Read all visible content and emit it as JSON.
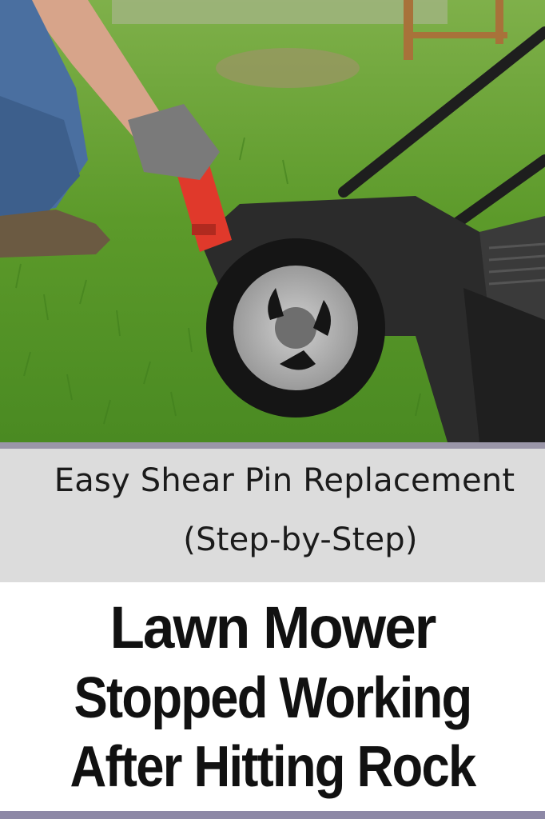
{
  "photo": {
    "description_icon": "lawn-mower-photo",
    "colors": {
      "grass": "#5e9a2c",
      "mower_body": "#2b2b2b",
      "handle_grip": "#e0392b",
      "glove": "#7a7a7a",
      "jeans": "#4a6fa0"
    }
  },
  "subtitle": {
    "line1": "Easy Shear Pin Replacement",
    "line2": "(Step-by-Step)"
  },
  "title": {
    "line1": "Lawn Mower",
    "line2": "Stopped Working",
    "line3": "After Hitting Rock"
  },
  "colors": {
    "subtitle_band": "#dcdcdc",
    "divider": "#9a96a8",
    "title_text": "#111111"
  }
}
